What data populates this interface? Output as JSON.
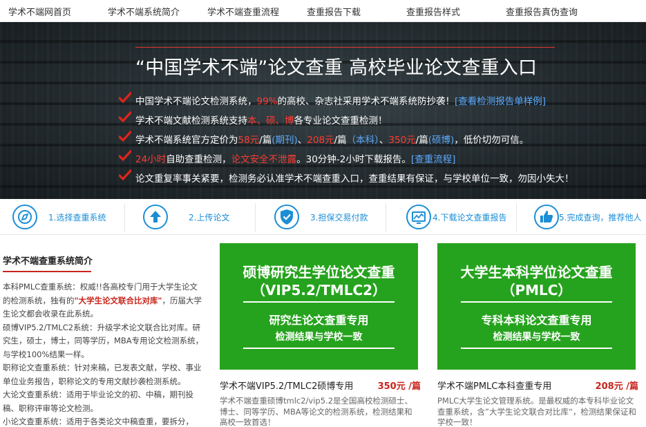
{
  "nav": {
    "items": [
      "学术不端网首页",
      "学术不端系统简介",
      "学术不端查重流程",
      "查重报告下载",
      "查重报告样式",
      "查重报告真伪查询"
    ]
  },
  "hero": {
    "title": "“中国学术不端”论文查重 高校毕业论文查重入口",
    "features": [
      [
        {
          "t": "中国学术不端论文检测系统，",
          "c": ""
        },
        {
          "t": "99%",
          "c": "red"
        },
        {
          "t": "的高校、杂志社采用学术不端系统防抄袭！",
          "c": ""
        },
        {
          "t": "[查看检测报告单样例]",
          "c": "blue"
        }
      ],
      [
        {
          "t": "学术不端文献检测系统支持",
          "c": ""
        },
        {
          "t": "本、硕、博",
          "c": "red"
        },
        {
          "t": "各专业论文查重检测！",
          "c": ""
        }
      ],
      [
        {
          "t": "学术不端系统官方定价为",
          "c": ""
        },
        {
          "t": "58元",
          "c": "red"
        },
        {
          "t": "/篇",
          "c": ""
        },
        {
          "t": "(期刊)",
          "c": "blue"
        },
        {
          "t": "、",
          "c": ""
        },
        {
          "t": "208元",
          "c": "red"
        },
        {
          "t": "/篇",
          "c": ""
        },
        {
          "t": "（本科）",
          "c": "blue"
        },
        {
          "t": "、",
          "c": ""
        },
        {
          "t": "350元",
          "c": "red"
        },
        {
          "t": "/篇",
          "c": ""
        },
        {
          "t": "(硕博)",
          "c": "blue"
        },
        {
          "t": "，低价切勿可信。",
          "c": ""
        }
      ],
      [
        {
          "t": "24小时",
          "c": "red"
        },
        {
          "t": "自助查重检测，",
          "c": ""
        },
        {
          "t": "论文安全不泄露",
          "c": "red"
        },
        {
          "t": "。30分钟-2小时下载报告。",
          "c": ""
        },
        {
          "t": "[查重流程]",
          "c": "blue"
        }
      ],
      [
        {
          "t": "论文重复率事关紧要，检测务必认准学术不端查重入口，查重结果有保证，与学校单位一致，勿因小失大！",
          "c": ""
        }
      ]
    ]
  },
  "steps": [
    {
      "label": "1.选择查重系统",
      "icon": "compass-icon"
    },
    {
      "label": "2.上传论文",
      "icon": "upload-icon"
    },
    {
      "label": "3.担保交易付款",
      "icon": "shield-check-icon"
    },
    {
      "label": "4.下载论文查重报告",
      "icon": "report-icon"
    },
    {
      "label": "5.完成查询，推荐他人",
      "icon": "thumbs-up-icon"
    }
  ],
  "intro": {
    "title": "学术不端查重系统简介",
    "paragraphs": [
      [
        {
          "t": "本科PMLC查重系统：",
          "c": "b"
        },
        {
          "t": "权威!!各高校专门用于大学生论文的检测系统，独有的",
          "c": ""
        },
        {
          "t": "\"大学生论文联合比对库\"",
          "c": "rb"
        },
        {
          "t": "，历届大学生论文都会收录在此系统。",
          "c": ""
        }
      ],
      [
        {
          "t": "硕博VIP5.2/TMLC2系统：",
          "c": "b"
        },
        {
          "t": "升级学术论文联合比对库。研究生，硕士，博士，同等学历，MBA专用论文检测系统，与学校100%结果一样。",
          "c": ""
        }
      ],
      [
        {
          "t": "职称论文查重系统：",
          "c": "b"
        },
        {
          "t": "针对来稿，已发表文献，学校、事业单位业务报告，职称论文的专用文献抄袭检测系统。",
          "c": ""
        }
      ],
      [
        {
          "t": "大论文查重系统：",
          "c": "b"
        },
        {
          "t": "适用于毕业论文的初、中稿，期刊投稿、职称评审等论文检测。",
          "c": ""
        }
      ],
      [
        {
          "t": "小论文查重系统：",
          "c": "b"
        },
        {
          "t": "适用于各类论文中稿查重，要拆分，",
          "c": ""
        }
      ]
    ]
  },
  "cards": [
    {
      "title_line1": "硕博研究生学位论文查重",
      "title_line2": "（VIP5.2/TMLC2）",
      "sub1": "研究生论文查重专用",
      "sub2": "检测结果与学校一致",
      "name": "学术不端VIP5.2/TMLC2硕博专用",
      "price": "350元 /篇",
      "desc": "学术不端查重硕博tmlc2/vip5.2是全国高校检测硕士、博士、同等学历、MBA等论文的检测系统，检测结果和高校一致首选！"
    },
    {
      "title_line1": "大学生本科学位论文查重",
      "title_line2": "（PMLC）",
      "sub1": "专科本科论文查重专用",
      "sub2": "检测结果与学校一致",
      "name": "学术不端PMLC本科查重专用",
      "price": "208元 /篇",
      "desc": "PMLC大学生论文管理系统。是最权威的本专科毕业论文查重系统，含”大学生论文联合对比库“，检测结果保证和学校一致！"
    }
  ],
  "colors": {
    "accent_blue": "#1b8ed6",
    "card_green": "#26a31e",
    "highlight_red": "#c9241b"
  }
}
